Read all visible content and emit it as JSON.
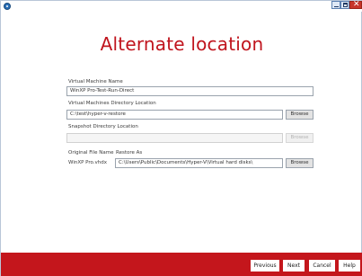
{
  "window": {
    "icon": "app-logo-icon",
    "controls": {
      "minimize_icon": "minimize-icon",
      "maximize_icon": "maximize-icon",
      "close_icon": "close-icon",
      "close_glyph": "✕"
    }
  },
  "heading": "Alternate location",
  "vm_name": {
    "label": "Virtual Machine Name",
    "value": "WinXP Pro-Test-Run-Direct"
  },
  "vm_dir": {
    "label": "Virtual Machines Directory Location",
    "value": "C:\\test\\hyper-v-restore",
    "browse_label": "Browse"
  },
  "snapshot_dir": {
    "label": "Snapshot Directory Location",
    "value": "",
    "browse_label": "Browse"
  },
  "files": {
    "col_original": "Original File Name",
    "col_restore": "Restore As",
    "rows": [
      {
        "original": "WinXP Pro.vhdx",
        "restore_as": "C:\\Users\\Public\\Documents\\Hyper-V\\Virtual hard disks\\",
        "browse_label": "Browse"
      }
    ]
  },
  "footer": {
    "previous": "Previous",
    "next": "Next",
    "cancel": "Cancel",
    "help": "Help"
  },
  "colors": {
    "accent": "#c4161c",
    "heading": "#c0141d"
  }
}
